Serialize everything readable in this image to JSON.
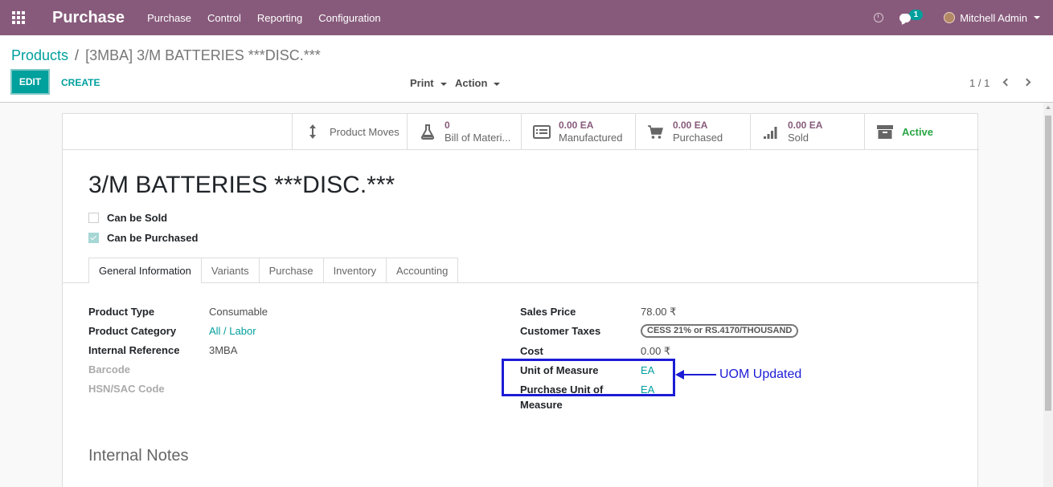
{
  "navbar": {
    "app_title": "Purchase",
    "menu": [
      "Purchase",
      "Control",
      "Reporting",
      "Configuration"
    ],
    "message_count": "1",
    "user_name": "Mitchell Admin",
    "bg_color": "#875a7b"
  },
  "breadcrumb": {
    "parent": "Products",
    "current": "[3MBA] 3/M BATTERIES ***DISC.***"
  },
  "toolbar": {
    "edit_label": "EDIT",
    "create_label": "CREATE",
    "print_label": "Print",
    "action_label": "Action",
    "pager": "1 / 1"
  },
  "smart_buttons": {
    "moves_label": "Product Moves",
    "bom_value": "0",
    "bom_label": "Bill of Materi...",
    "manufactured_value": "0.00 EA",
    "manufactured_label": "Manufactured",
    "purchased_value": "0.00 EA",
    "purchased_label": "Purchased",
    "sold_value": "0.00 EA",
    "sold_label": "Sold",
    "active_label": "Active"
  },
  "product": {
    "name": "3/M BATTERIES ***DISC.***",
    "can_be_sold_label": "Can be Sold",
    "can_be_sold": false,
    "can_be_purchased_label": "Can be Purchased",
    "can_be_purchased": true
  },
  "tabs": [
    "General Information",
    "Variants",
    "Purchase",
    "Inventory",
    "Accounting"
  ],
  "general": {
    "product_type_label": "Product Type",
    "product_type": "Consumable",
    "category_label": "Product Category",
    "category": "All / Labor",
    "internal_ref_label": "Internal Reference",
    "internal_ref": "3MBA",
    "barcode_label": "Barcode",
    "hsn_label": "HSN/SAC Code",
    "sales_price_label": "Sales Price",
    "sales_price": "78.00 ₹",
    "customer_taxes_label": "Customer Taxes",
    "customer_tax": "CESS 21% or RS.4170/THOUSAND",
    "cost_label": "Cost",
    "cost": "0.00 ₹",
    "uom_label": "Unit of Measure",
    "uom": "EA",
    "purchase_uom_label_line1": "Purchase Unit of",
    "purchase_uom_label_line2": "Measure",
    "purchase_uom": "EA"
  },
  "annotation": {
    "text": "UOM Updated",
    "color": "#1c1cd6"
  },
  "notes": {
    "title": "Internal Notes"
  }
}
